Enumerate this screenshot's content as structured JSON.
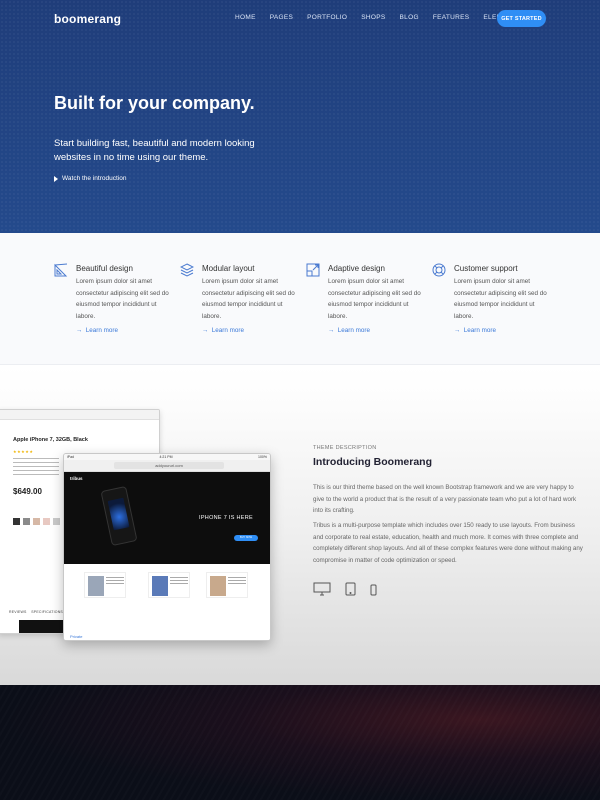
{
  "header": {
    "logo": "boomerang",
    "nav": [
      "HOME",
      "PAGES",
      "PORTFOLIO",
      "SHOPS",
      "BLOG",
      "FEATURES",
      "ELEMENTS"
    ],
    "cta": "GET STARTED"
  },
  "hero": {
    "title": "Built for your company.",
    "subtitle": "Start building fast, beautiful and modern looking websites in no time using our theme.",
    "watch": "Watch the introduction"
  },
  "features": [
    {
      "icon": "design-icon",
      "title": "Beautiful design",
      "body": "Lorem ipsum dolor sit amet consectetur adipiscing elit sed do eiusmod tempor incididunt ut labore.",
      "link": "Learn more"
    },
    {
      "icon": "layers-icon",
      "title": "Modular layout",
      "body": "Lorem ipsum dolor sit amet consectetur adipiscing elit sed do eiusmod tempor incididunt ut labore.",
      "link": "Learn more"
    },
    {
      "icon": "expand-icon",
      "title": "Adaptive design",
      "body": "Lorem ipsum dolor sit amet consectetur adipiscing elit sed do eiusmod tempor incididunt ut labore.",
      "link": "Learn more"
    },
    {
      "icon": "support-icon",
      "title": "Customer support",
      "body": "Lorem ipsum dolor sit amet consectetur adipiscing elit sed do eiusmod tempor incididunt ut labore.",
      "link": "Learn more"
    }
  ],
  "intro": {
    "label": "THEME DESCRIPTION",
    "title": "Introducing Boomerang",
    "p1": "This is our third theme based on the well known Bootstrap framework and we are very happy to give to the world a product that is the result of a very passionate team who put a lot of hard work into its crafting.",
    "p2": "Tribus is a multi-purpose template which includes over 150 ready to use layouts. From business and corporate to real estate, education, health and much more. It comes with three complete and completely different shop layouts. And all of these complex features were done without making any compromise in matter of code optimization or speed."
  },
  "mockup": {
    "product_title": "Apple iPhone 7, 32GB, Black",
    "price": "$649.00",
    "reviews_tab": "REVIEWS",
    "specs_tab": "SPECIFICATIONS",
    "url": "addyoururl.com",
    "brand": "tribus",
    "headline": "IPHONE 7 IS HERE",
    "buy": "BUY NOW",
    "statusbar_left": "iPad",
    "statusbar_center": "4:21 PM",
    "statusbar_right": "100%",
    "footer_link": "Private"
  },
  "colors": {
    "hero_bg": "#244a8c",
    "accent": "#2f8ef5",
    "link": "#3a78d8"
  }
}
